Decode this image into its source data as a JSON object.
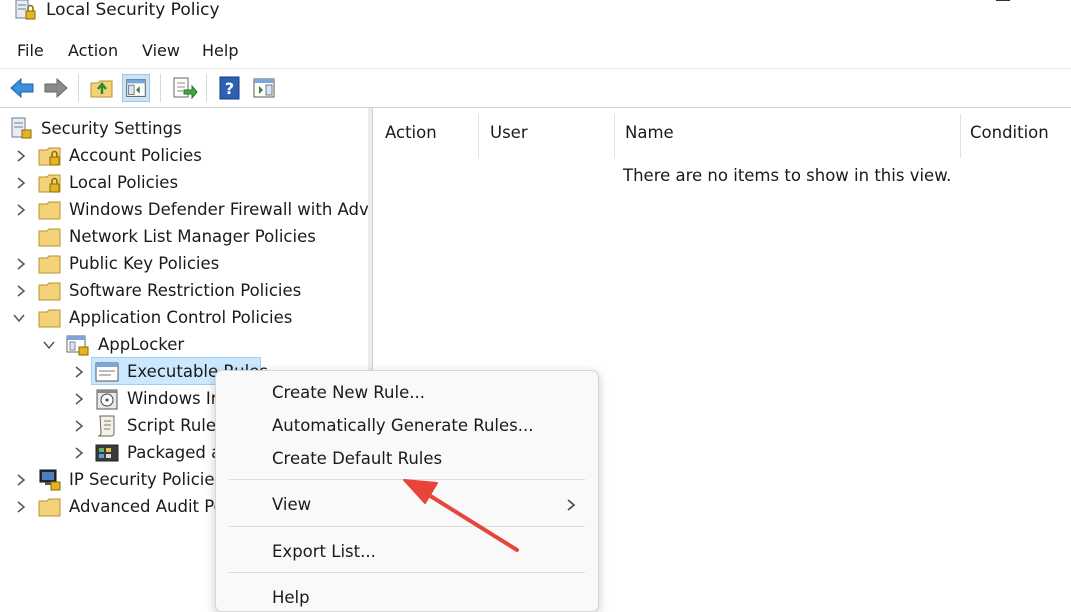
{
  "window": {
    "title": "Local Security Policy"
  },
  "menubar": {
    "items": [
      "File",
      "Action",
      "View",
      "Help"
    ]
  },
  "toolbar": {
    "buttons": [
      "back-arrow-icon",
      "forward-arrow-icon",
      "up-folder-icon",
      "show-hide-tree-icon",
      "export-list-icon",
      "help-icon",
      "properties-pane-icon"
    ]
  },
  "tree": {
    "root": "Security Settings",
    "items": [
      {
        "label": "Account Policies"
      },
      {
        "label": "Local Policies"
      },
      {
        "label": "Windows Defender Firewall with Advar"
      },
      {
        "label": "Network List Manager Policies"
      },
      {
        "label": "Public Key Policies"
      },
      {
        "label": "Software Restriction Policies"
      },
      {
        "label": "Application Control Policies"
      },
      {
        "label": "AppLocker"
      },
      {
        "label": "Executable Rules"
      },
      {
        "label": "Windows Ir"
      },
      {
        "label": "Script Rules"
      },
      {
        "label": "Packaged a"
      },
      {
        "label": "IP Security Policies"
      },
      {
        "label": "Advanced Audit Po"
      }
    ]
  },
  "list": {
    "columns": [
      "Action",
      "User",
      "Name",
      "Condition"
    ],
    "empty_message": "There are no items to show in this view."
  },
  "context_menu": {
    "items": [
      "Create New Rule...",
      "Automatically Generate Rules...",
      "Create Default Rules",
      "View",
      "Export List...",
      "Help"
    ]
  },
  "colors": {
    "annotation_arrow": "#e8443a",
    "selection": "#cce8ff",
    "folder": "#f3d27a"
  }
}
